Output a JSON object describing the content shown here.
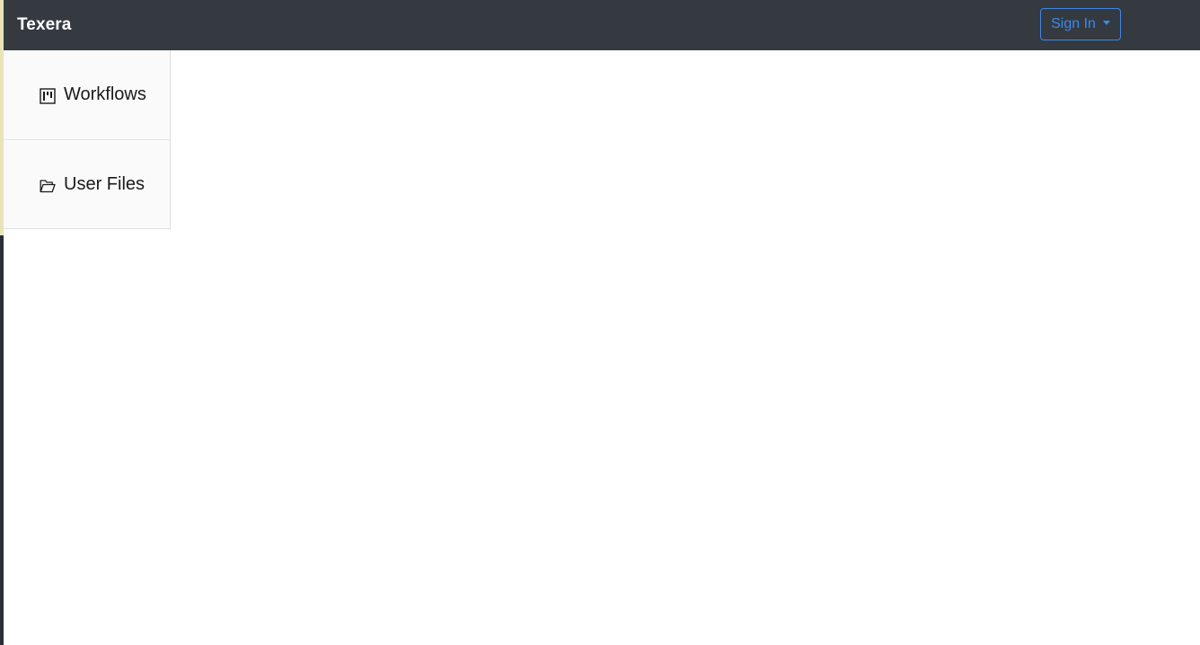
{
  "navbar": {
    "brand": "Texera",
    "signin_label": "Sign In"
  },
  "sidebar": {
    "items": [
      {
        "label": "Workflows",
        "icon": "project-board-icon"
      },
      {
        "label": "User Files",
        "icon": "folder-open-icon"
      }
    ]
  },
  "colors": {
    "navbar_bg": "#343a40",
    "accent": "#3a8af0",
    "sidebar_bg": "#fafafa"
  }
}
